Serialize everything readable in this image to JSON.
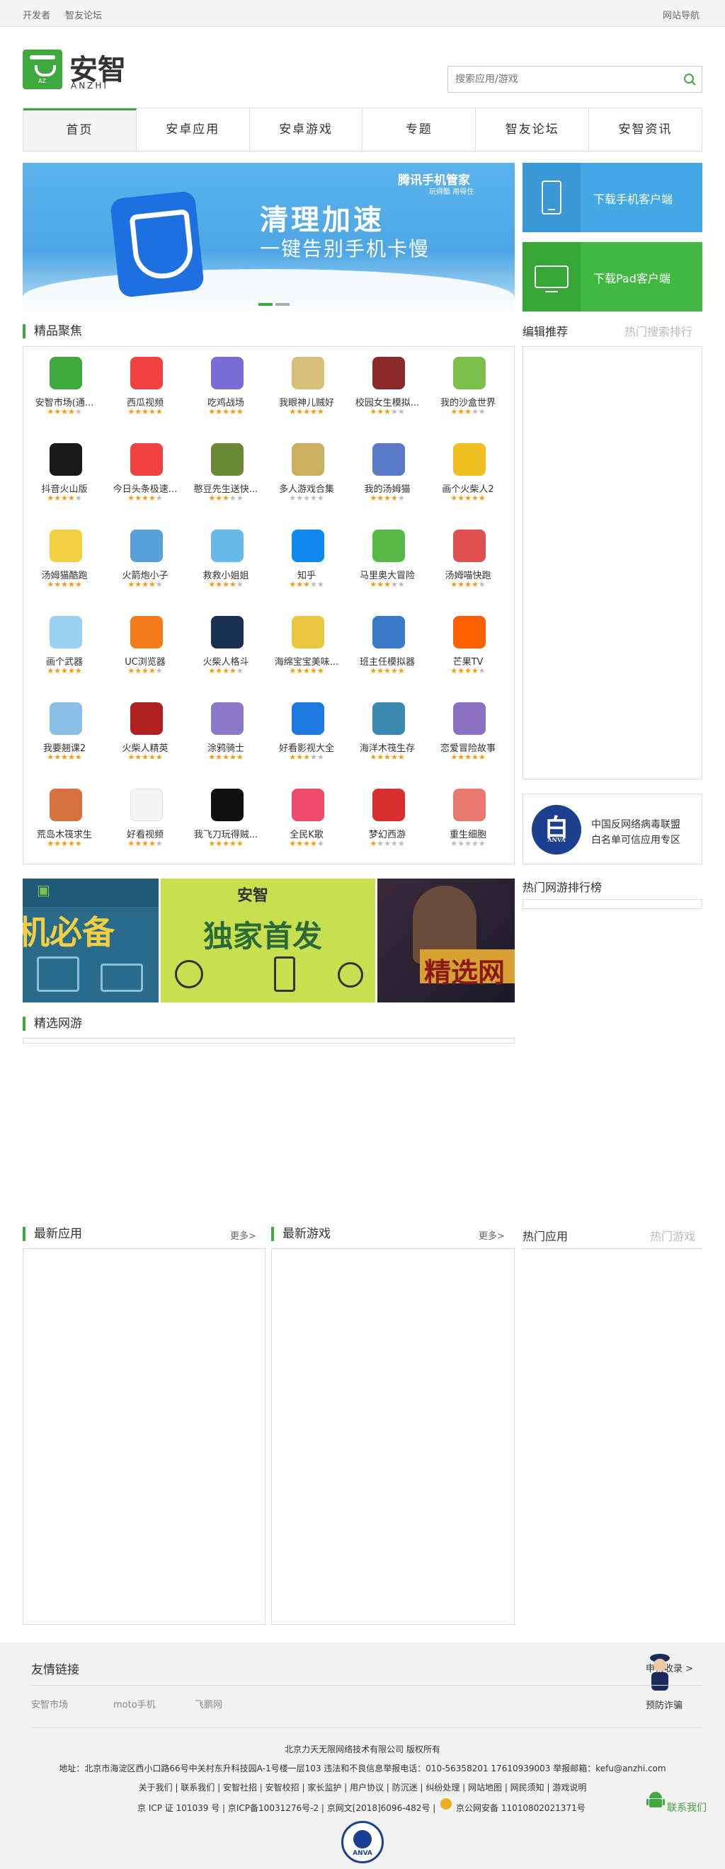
{
  "topbar": {
    "dev": "开发者",
    "forum": "智友论坛",
    "sitenav": "网站导航"
  },
  "logo": {
    "cn": "安智",
    "en": "ANZHI",
    "bag_text": "AZ"
  },
  "search": {
    "placeholder": "搜索应用/游戏"
  },
  "nav": [
    "首页",
    "安卓应用",
    "安卓游戏",
    "专题",
    "智友论坛",
    "安智资讯"
  ],
  "banner": {
    "title": "清理加速",
    "subtitle": "一键告别手机卡慢",
    "brand": "腾讯手机管家",
    "brand_sub": "玩得酷 用得住"
  },
  "download": {
    "phone": "下载手机客户端",
    "pad": "下载Pad客户端"
  },
  "featured": {
    "title": "精品聚焦",
    "apps": [
      {
        "name": "安智市场(通...",
        "stars": 4,
        "color": "#3fa83f"
      },
      {
        "name": "西瓜视频",
        "stars": 5,
        "color": "#f04142"
      },
      {
        "name": "吃鸡战场",
        "stars": 5,
        "color": "#7a6bd6"
      },
      {
        "name": "我眼神儿贼好",
        "stars": 5,
        "color": "#d8c07a"
      },
      {
        "name": "校园女生模拟...",
        "stars": 3,
        "color": "#8a2a2a"
      },
      {
        "name": "我的沙盒世界",
        "stars": 3,
        "color": "#7ac04a"
      },
      {
        "name": "抖音火山版",
        "stars": 4,
        "color": "#1a1a1a"
      },
      {
        "name": "今日头条极速...",
        "stars": 4,
        "color": "#f04142"
      },
      {
        "name": "憨豆先生送快...",
        "stars": 3,
        "color": "#6a8a3a"
      },
      {
        "name": "多人游戏合集",
        "stars": 0,
        "color": "#c8b060"
      },
      {
        "name": "我的汤姆猫",
        "stars": 4,
        "color": "#5a7ac8"
      },
      {
        "name": "画个火柴人2",
        "stars": 5,
        "color": "#f0c020"
      },
      {
        "name": "汤姆猫酷跑",
        "stars": 5,
        "color": "#f0d040"
      },
      {
        "name": "火箭炮小子",
        "stars": 4,
        "color": "#5aa0d8"
      },
      {
        "name": "救救小姐姐",
        "stars": 4,
        "color": "#68b8e8"
      },
      {
        "name": "知乎",
        "stars": 3,
        "color": "#0f88eb"
      },
      {
        "name": "马里奥大冒险",
        "stars": 3,
        "color": "#58b848"
      },
      {
        "name": "汤姆喵快跑",
        "stars": 4,
        "color": "#e05050"
      },
      {
        "name": "画个武器",
        "stars": 5,
        "color": "#9ad0f0"
      },
      {
        "name": "UC浏览器",
        "stars": 4,
        "color": "#f37b1d"
      },
      {
        "name": "火柴人格斗",
        "stars": 4,
        "color": "#1a3050"
      },
      {
        "name": "海绵宝宝美味...",
        "stars": 5,
        "color": "#e8c840"
      },
      {
        "name": "班主任模拟器",
        "stars": 5,
        "color": "#3a78c8"
      },
      {
        "name": "芒果TV",
        "stars": 4,
        "color": "#ff5f00"
      },
      {
        "name": "我要翘课2",
        "stars": 5,
        "color": "#8ac0e8"
      },
      {
        "name": "火柴人精英",
        "stars": 5,
        "color": "#b02020"
      },
      {
        "name": "涂鸦骑士",
        "stars": 5,
        "color": "#8a78c8"
      },
      {
        "name": "好看影视大全",
        "stars": 3,
        "color": "#1a7ae0"
      },
      {
        "name": "海洋木筏生存",
        "stars": 5,
        "color": "#3a8ab0"
      },
      {
        "name": "恋爱冒险故事",
        "stars": 5,
        "color": "#8a70c0"
      },
      {
        "name": "荒岛木筏求生",
        "stars": 5,
        "color": "#d87040"
      },
      {
        "name": "好看视频",
        "stars": 4,
        "color": "#f5f5f5"
      },
      {
        "name": "我飞刀玩得贼...",
        "stars": 5,
        "color": "#101010"
      },
      {
        "name": "全民K歌",
        "stars": 4,
        "color": "#f04a6a"
      },
      {
        "name": "梦幻西游",
        "stars": 1,
        "color": "#d83030"
      },
      {
        "name": "重生细胞",
        "stars": 0,
        "color": "#e87870"
      }
    ]
  },
  "editor": {
    "tab1": "编辑推荐",
    "tab2": "热门搜索排行"
  },
  "anva": {
    "badge": "白",
    "badge_en": "ANVA",
    "line1": "中国反网络病毒联盟",
    "line2": "白名单可信应用专区"
  },
  "promo": {
    "p1": "机必备",
    "p2_logo": "安智",
    "p2": "独家首发",
    "p3": "精选网"
  },
  "hot_games": {
    "title": "热门网游排行榜"
  },
  "online": {
    "title": "精选网游"
  },
  "latest_apps": {
    "title": "最新应用",
    "more": "更多>"
  },
  "latest_games": {
    "title": "最新游戏",
    "more": "更多>"
  },
  "hot_apps": {
    "tab1": "热门应用",
    "tab2": "热门游戏"
  },
  "friends": {
    "title": "友情链接",
    "apply": "申请收录 >",
    "links": [
      "安智市场",
      "moto手机",
      "飞鹏网"
    ],
    "fraud": "预防诈骗"
  },
  "footer": {
    "company": "北京力天无限网络技术有限公司 版权所有",
    "address": "地址：北京市海淀区西小口路66号中关村东升科技园A-1号楼一层103 违法和不良信息举报电话：010-56358201   17610939003 举报邮箱：kefu@anzhi.com",
    "links": "关于我们  |  联系我们  |  安智社招  |  安智校招  |  家长监护 | 用户协议 | 防沉迷 | 纠纷处理 |  网站地图 |  网民须知 |  游戏说明",
    "icp": "京 ICP 证 101039 号 | 京ICP备10031276号-2 | 京网文[2018]6096-482号 |",
    "police": "京公网安备 11010802021371号",
    "contact": "联系我们",
    "seal": "ANVA"
  }
}
